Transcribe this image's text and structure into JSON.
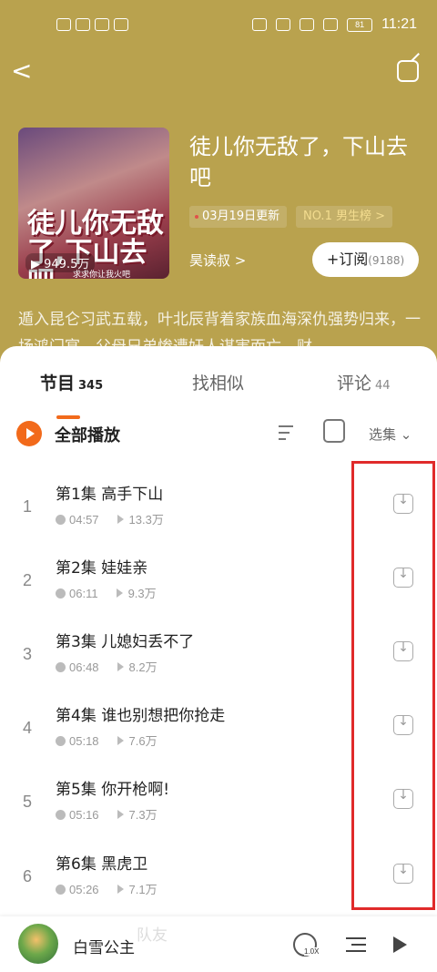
{
  "status_bar": {
    "left_icons": [
      "hd-icon",
      "5g-signal-icon",
      "wifi-icon",
      "data-icon"
    ],
    "battery": "81",
    "time": "11:21"
  },
  "header": {
    "back": "<",
    "share": "share-icon"
  },
  "book": {
    "cover_title": "徒儿你无敌了,下山去吧",
    "cover_subtitle": "求求你让我火吧",
    "plays": "949.5万",
    "title": "徒儿你无敌了，下山去吧",
    "updated": "03月19日更新",
    "rank": "NO.1 男生榜 >",
    "author": "昊读叔 >",
    "subscribe_label": "+订阅",
    "subscribe_count": "(9188)",
    "description": "遁入昆仑习武五载，叶北辰背着家族血海深仇强势归来，一场鸿门宴，父母兄弟惨遭奸人谋害而亡，财"
  },
  "tabs": [
    {
      "label": "节目",
      "badge": "345"
    },
    {
      "label": "找相似",
      "badge": ""
    },
    {
      "label": "评论",
      "badge": "44"
    }
  ],
  "list_header": {
    "play_all": "全部播放",
    "select_episodes": "选集 ⌄"
  },
  "episodes": [
    {
      "num": "1",
      "title": "第1集 高手下山",
      "duration": "04:57",
      "plays": "13.3万"
    },
    {
      "num": "2",
      "title": "第2集 娃娃亲",
      "duration": "06:11",
      "plays": "9.3万"
    },
    {
      "num": "3",
      "title": "第3集 儿媳妇丢不了",
      "duration": "06:48",
      "plays": "8.2万"
    },
    {
      "num": "4",
      "title": "第4集 谁也别想把你抢走",
      "duration": "05:18",
      "plays": "7.6万"
    },
    {
      "num": "5",
      "title": "第5集 你开枪啊!",
      "duration": "05:16",
      "plays": "7.3万"
    },
    {
      "num": "6",
      "title": "第6集 黑虎卫",
      "duration": "05:26",
      "plays": "7.1万"
    }
  ],
  "player": {
    "title": "白雪公主",
    "ghost_text": "队友",
    "speed": "1.0X"
  },
  "colors": {
    "header_bg": "#b9a24e",
    "accent": "#f26a1b",
    "highlight": "#e02a2a"
  }
}
